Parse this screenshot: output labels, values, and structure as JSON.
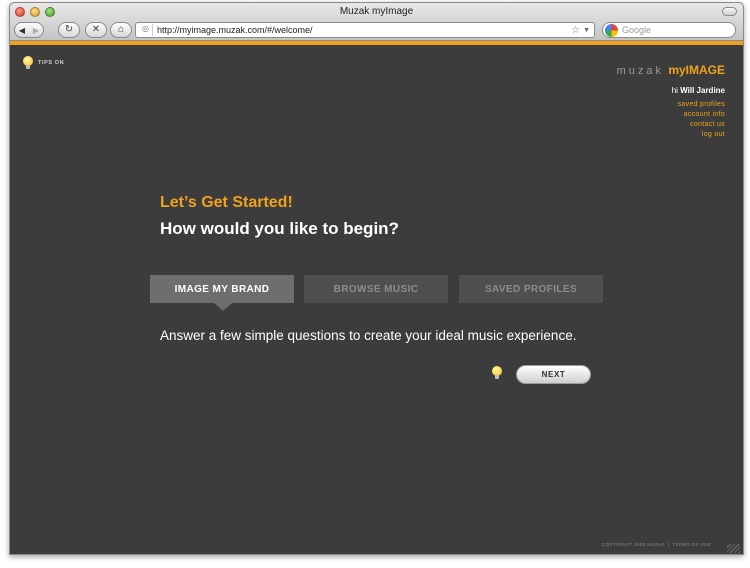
{
  "window": {
    "title": "Muzak myImage"
  },
  "toolbar": {
    "back_icon": "back-arrow-icon",
    "forward_icon": "forward-arrow-icon",
    "url": "http://myimage.muzak.com/#/welcome/",
    "search_placeholder": "Google"
  },
  "tips": {
    "label": "TIPS ON"
  },
  "brand": {
    "part1": "muzak",
    "part2": "myIMAGE"
  },
  "user": {
    "greeting": "hi",
    "name": "Will Jardine",
    "links": [
      "saved profiles",
      "account info",
      "contact us",
      "log out"
    ]
  },
  "main": {
    "headline": "Let’s Get Started!",
    "subhead": "How would you like to begin?",
    "tabs": [
      {
        "label": "IMAGE MY BRAND",
        "active": true
      },
      {
        "label": "BROWSE MUSIC",
        "active": false
      },
      {
        "label": "SAVED PROFILES",
        "active": false
      }
    ],
    "description": "Answer a few simple questions to create your ideal music experience.",
    "next_label": "NEXT"
  },
  "footer": {
    "copyright": "COPYRIGHT 2008 MUZAK",
    "separator": "|",
    "terms": "TERMS OF USE"
  },
  "colors": {
    "accent": "#f0a21c",
    "background": "#3c3c3c",
    "tab_active": "#6e6e6e",
    "tab_inactive": "#4f4f4f"
  }
}
